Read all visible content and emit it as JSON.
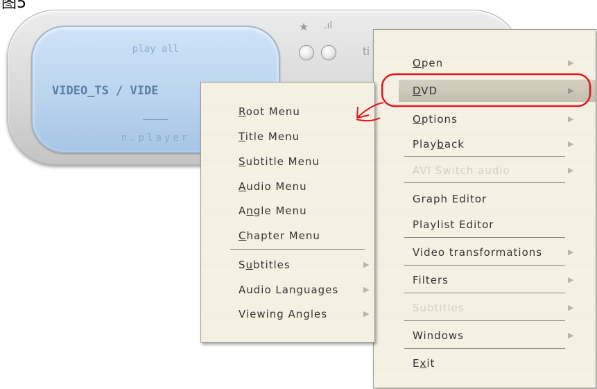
{
  "figure_label": "图5",
  "player": {
    "play_all": "play all",
    "title": "VIDEO_TS / VIDE",
    "wave": "﹏﹏﹏",
    "brand": "n.player",
    "star": "★",
    "signal": ".ıl",
    "side_text": "ti"
  },
  "main_menu": {
    "items": [
      {
        "label": "Open",
        "mnemonic": "O",
        "rest": "pen",
        "submenu": true
      },
      {
        "label": "DVD",
        "mnemonic": "D",
        "rest": "VD",
        "submenu": true,
        "highlighted": true
      },
      {
        "label": "Options",
        "mnemonic": "O",
        "rest": "ptions",
        "submenu": true
      },
      {
        "label": "Playback",
        "pre": "Play",
        "mnemonic": "b",
        "rest": "ack",
        "submenu": true
      },
      {
        "label": "AVI Switch audio",
        "submenu": true,
        "disabled": true
      },
      {
        "label": "Graph Editor"
      },
      {
        "label": "Playlist Editor"
      },
      {
        "label": "Video transformations",
        "submenu": true
      },
      {
        "label": "Filters",
        "submenu": true
      },
      {
        "label": "Subtitles",
        "submenu": true,
        "disabled": true
      },
      {
        "label": "Windows",
        "submenu": true
      },
      {
        "label": "Exit",
        "pre": "E",
        "mnemonic": "x",
        "rest": "it"
      }
    ]
  },
  "dvd_submenu": {
    "items": [
      {
        "label": "Root Menu",
        "mnemonic": "R",
        "rest": "oot Menu"
      },
      {
        "label": "Title Menu",
        "mnemonic": "T",
        "rest": "itle Menu"
      },
      {
        "label": "Subtitle Menu",
        "mnemonic": "S",
        "rest": "ubtitle Menu"
      },
      {
        "label": "Audio Menu",
        "mnemonic": "A",
        "rest": "udio Menu"
      },
      {
        "label": "Angle Menu",
        "pre": "A",
        "mnemonic": "n",
        "rest": "gle Menu"
      },
      {
        "label": "Chapter Menu",
        "mnemonic": "C",
        "rest": "hapter Menu"
      },
      {
        "label": "Subtitles",
        "pre": "S",
        "mnemonic": "u",
        "rest": "btitles",
        "submenu": true
      },
      {
        "label": "Audio Languages",
        "submenu": true
      },
      {
        "label": "Viewing Angles",
        "submenu": true
      }
    ]
  },
  "colors": {
    "annotation": "#e8141c",
    "menu_bg": "#f6f2e4",
    "screen_bg": "#b9d3ee"
  },
  "icons": {
    "submenu_arrow": "▶"
  }
}
